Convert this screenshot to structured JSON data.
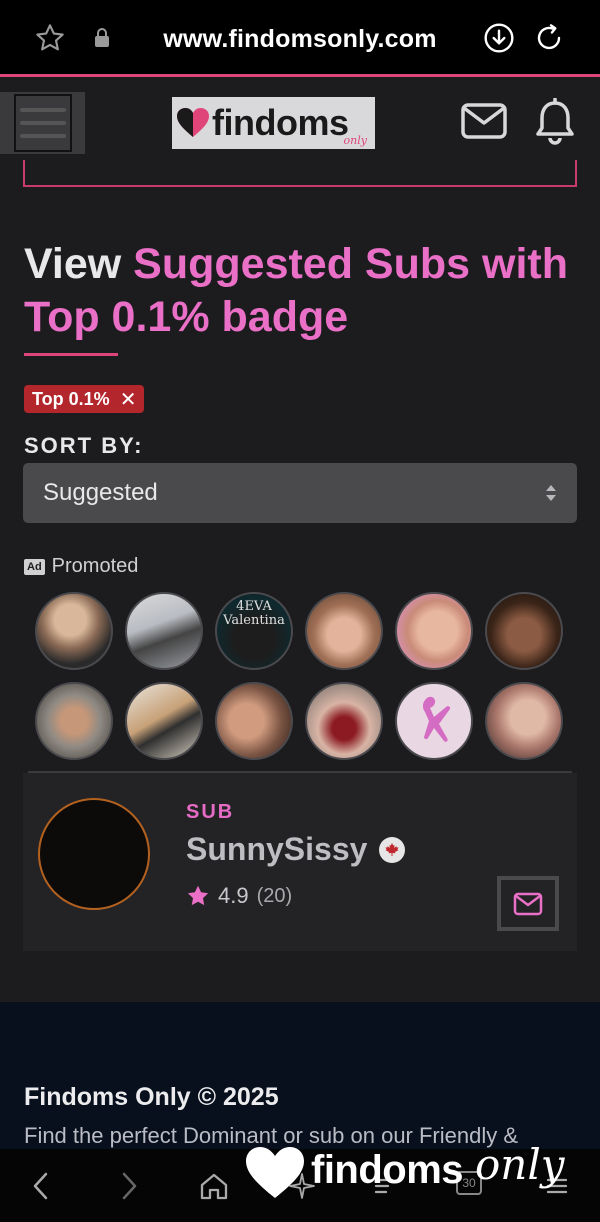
{
  "browser": {
    "url": "www.findomsonly.com",
    "icons": [
      "star-icon",
      "lock-icon",
      "download-icon",
      "reload-icon"
    ]
  },
  "header": {
    "logo_text": "findoms",
    "logo_sub": "only",
    "icons": [
      "hamburger-icon",
      "mail-icon",
      "bell-icon"
    ]
  },
  "page": {
    "title_plain": "View ",
    "title_accent": "Suggested Subs with Top 0.1% badge",
    "filter_chip": "Top 0.1%",
    "filter_chip_close": "✕",
    "sort_label": "SORT BY:",
    "sort_value": "Suggested"
  },
  "promoted": {
    "ad_badge": "Ad",
    "label": "Promoted",
    "avatar_caption": "4EVA\nValentina"
  },
  "card": {
    "role": "SUB",
    "name": "SunnySissy",
    "rating": "4.9",
    "rating_count": "(20)"
  },
  "footer": {
    "title": "Findoms Only © 2025",
    "text": "Find the perfect Dominant or sub on our Friendly &"
  },
  "watermark": {
    "text": "findoms",
    "script": "only"
  },
  "bottom_nav": {
    "tabs_count": "30"
  },
  "colors": {
    "accent_pink": "#ea6fc7",
    "brand_pink": "#e0457a",
    "chip_red": "#b3262b",
    "background": "#1c1c1e",
    "footer_bg": "#08101d"
  }
}
